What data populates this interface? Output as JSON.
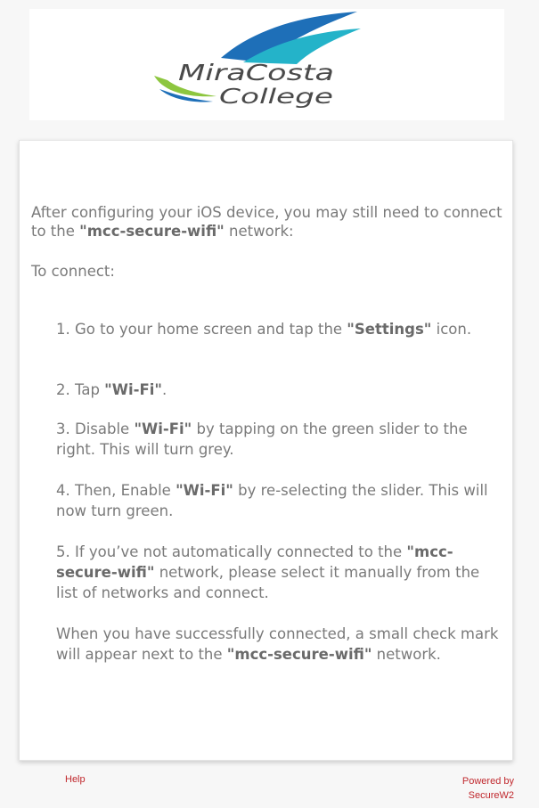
{
  "logo": {
    "line1": "MiraCosta",
    "line2": "College",
    "colors": {
      "text": "#4a4a4a",
      "swoosh_blue": "#1e6fb8",
      "swoosh_teal": "#24b3c9",
      "swoosh_green": "#8dc63f"
    }
  },
  "content": {
    "intro": {
      "before": "After configuring your iOS device, you may still need to connect to the ",
      "network": "\"mcc-secure-wifi\"",
      "after": " network:"
    },
    "to_connect": "To connect:",
    "steps": [
      {
        "before": "1. Go to your home screen and tap the ",
        "bold": "\"Settings\"",
        "after": " icon."
      },
      {
        "before": "2. Tap ",
        "bold": "\"Wi-Fi\"",
        "after": "."
      },
      {
        "before": "3. Disable ",
        "bold": "\"Wi-Fi\"",
        "after": " by tapping on the green slider to the right. This will turn grey."
      },
      {
        "before": "4. Then, Enable ",
        "bold": "\"Wi-Fi\"",
        "after": " by re-selecting the slider. This will now turn green."
      },
      {
        "before": "5. If you’ve not automatically connected to the ",
        "bold": "\"mcc-secure-wifi\"",
        "after": " network, please select it manually from the list of networks and connect."
      }
    ],
    "closing": {
      "before": "When you have successfully connected, a small check mark will appear next to the ",
      "bold": "\"mcc-secure-wifi\"",
      "after": " network."
    }
  },
  "footer": {
    "help": "Help",
    "powered_line1": "Powered by",
    "powered_line2": "SecureW2",
    "link_color": "#c0282d"
  }
}
